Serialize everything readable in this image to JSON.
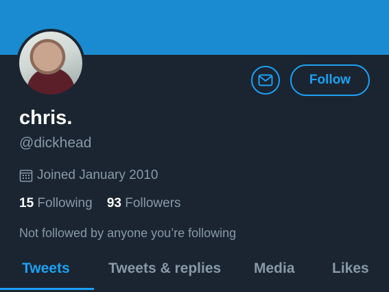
{
  "profile": {
    "name": "chris.",
    "handle": "@dickhead",
    "joined": "Joined January 2010",
    "following_count": "15",
    "following_label": "Following",
    "followers_count": "93",
    "followers_label": "Followers",
    "not_followed_text": "Not followed by anyone you’re following"
  },
  "actions": {
    "follow_label": "Follow",
    "message_icon": "envelope-icon"
  },
  "tabs": [
    {
      "label": "Tweets",
      "active": true
    },
    {
      "label": "Tweets & replies",
      "active": false
    },
    {
      "label": "Media",
      "active": false
    },
    {
      "label": "Likes",
      "active": false
    }
  ],
  "colors": {
    "background": "#1b2532",
    "banner": "#1a8bd0",
    "accent": "#1da1f2",
    "muted": "#8899a6",
    "text": "#ffffff"
  }
}
